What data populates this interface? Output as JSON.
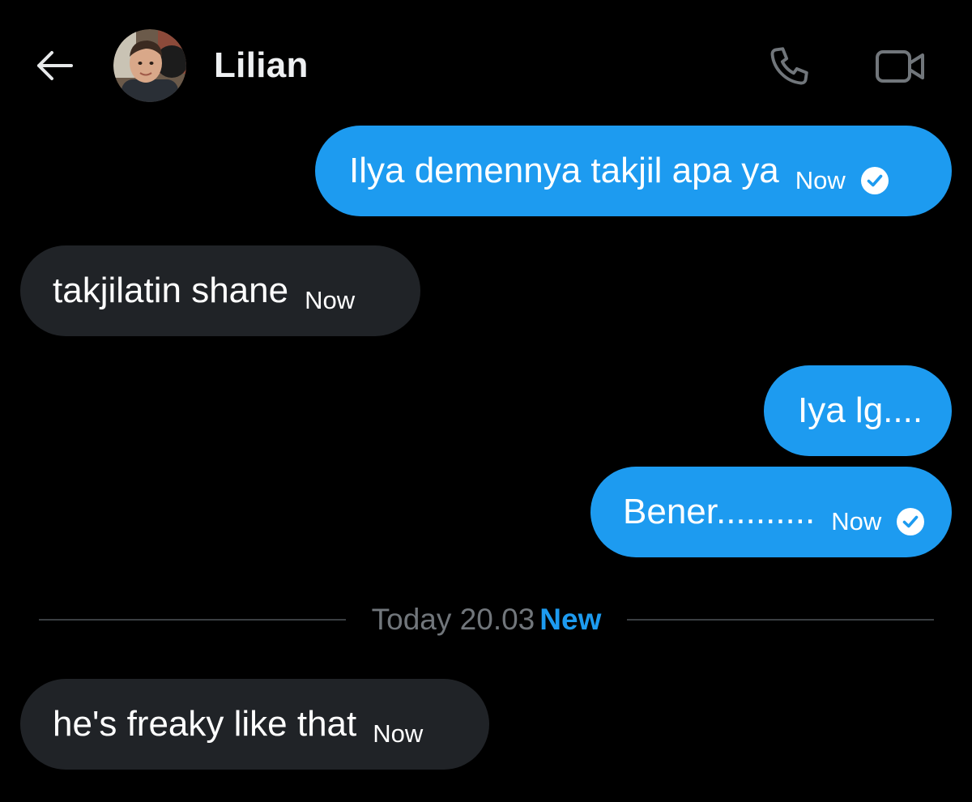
{
  "header": {
    "contact_name": "Lilian",
    "back_icon": "arrow-left-icon",
    "call_icon": "phone-icon",
    "video_icon": "video-camera-icon"
  },
  "messages": [
    {
      "direction": "sent",
      "text": "Ilya demennya takjil apa ya",
      "time": "Now",
      "status": "read"
    },
    {
      "direction": "received",
      "text": "takjilatin shane",
      "time": "Now"
    },
    {
      "direction": "sent",
      "text": "Iya lg....",
      "time": ""
    },
    {
      "direction": "sent",
      "text": "Bener..........",
      "time": "Now",
      "status": "read"
    },
    {
      "direction": "received",
      "text": "he's freaky like that",
      "time": "Now"
    }
  ],
  "divider": {
    "label": "Today 20.03",
    "badge": "New"
  },
  "colors": {
    "background": "#000000",
    "sent_bubble": "#1d9bf0",
    "received_bubble": "#202327",
    "muted_text": "#71767b",
    "accent": "#1d9bf0"
  }
}
